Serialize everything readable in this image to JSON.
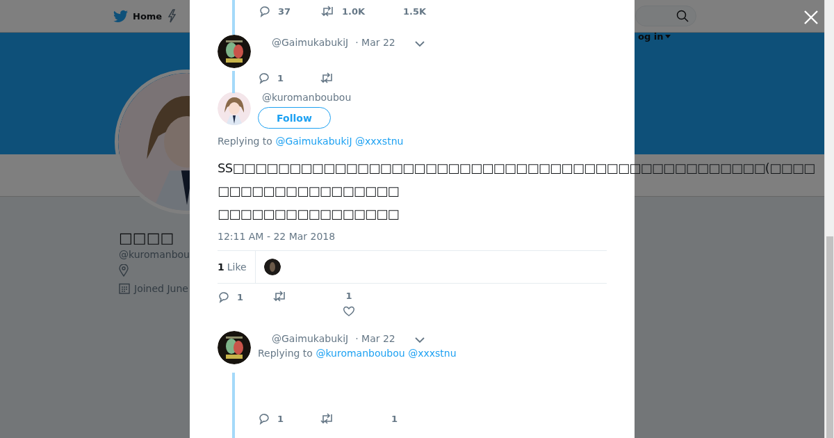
{
  "background": {
    "nav": {
      "home": "Home",
      "login": "og in"
    },
    "profile": {
      "name": "□□□□",
      "handle": "@kuromanbou",
      "joined": "Joined June"
    }
  },
  "modal": {
    "tweets": [
      {
        "kind": "stub",
        "replies": "37",
        "retweets": "1.0K",
        "likes": "1.5K"
      },
      {
        "kind": "compact",
        "handle": "@GaimukabukiJ",
        "date": "· Mar 22",
        "replies": "1"
      },
      {
        "kind": "main",
        "handle": "@kuromanboubou",
        "follow": "Follow",
        "replying_label": "Replying to",
        "replying_to": [
          "@GaimukabukiJ",
          "@xxxstnu"
        ],
        "text": "SS□□□□□□□□□□□□□□□□□□□□□□□□□□□□□□□□□□□□□□□□□□□□□□□(□□□□\n□□□□□□□□□□□□□□□□\n□□□□□□□□□□□□□□□□",
        "timestamp": "12:11 AM - 22 Mar 2018",
        "like_count": "1",
        "like_label": "Like",
        "replies": "1",
        "likes": "1"
      },
      {
        "kind": "compact",
        "handle": "@GaimukabukiJ",
        "date": "· Mar 22",
        "replying_label": "Replying to",
        "replying_to": [
          "@kuromanboubou",
          "@xxxstnu"
        ],
        "replies": "1",
        "likes": "1"
      }
    ]
  }
}
